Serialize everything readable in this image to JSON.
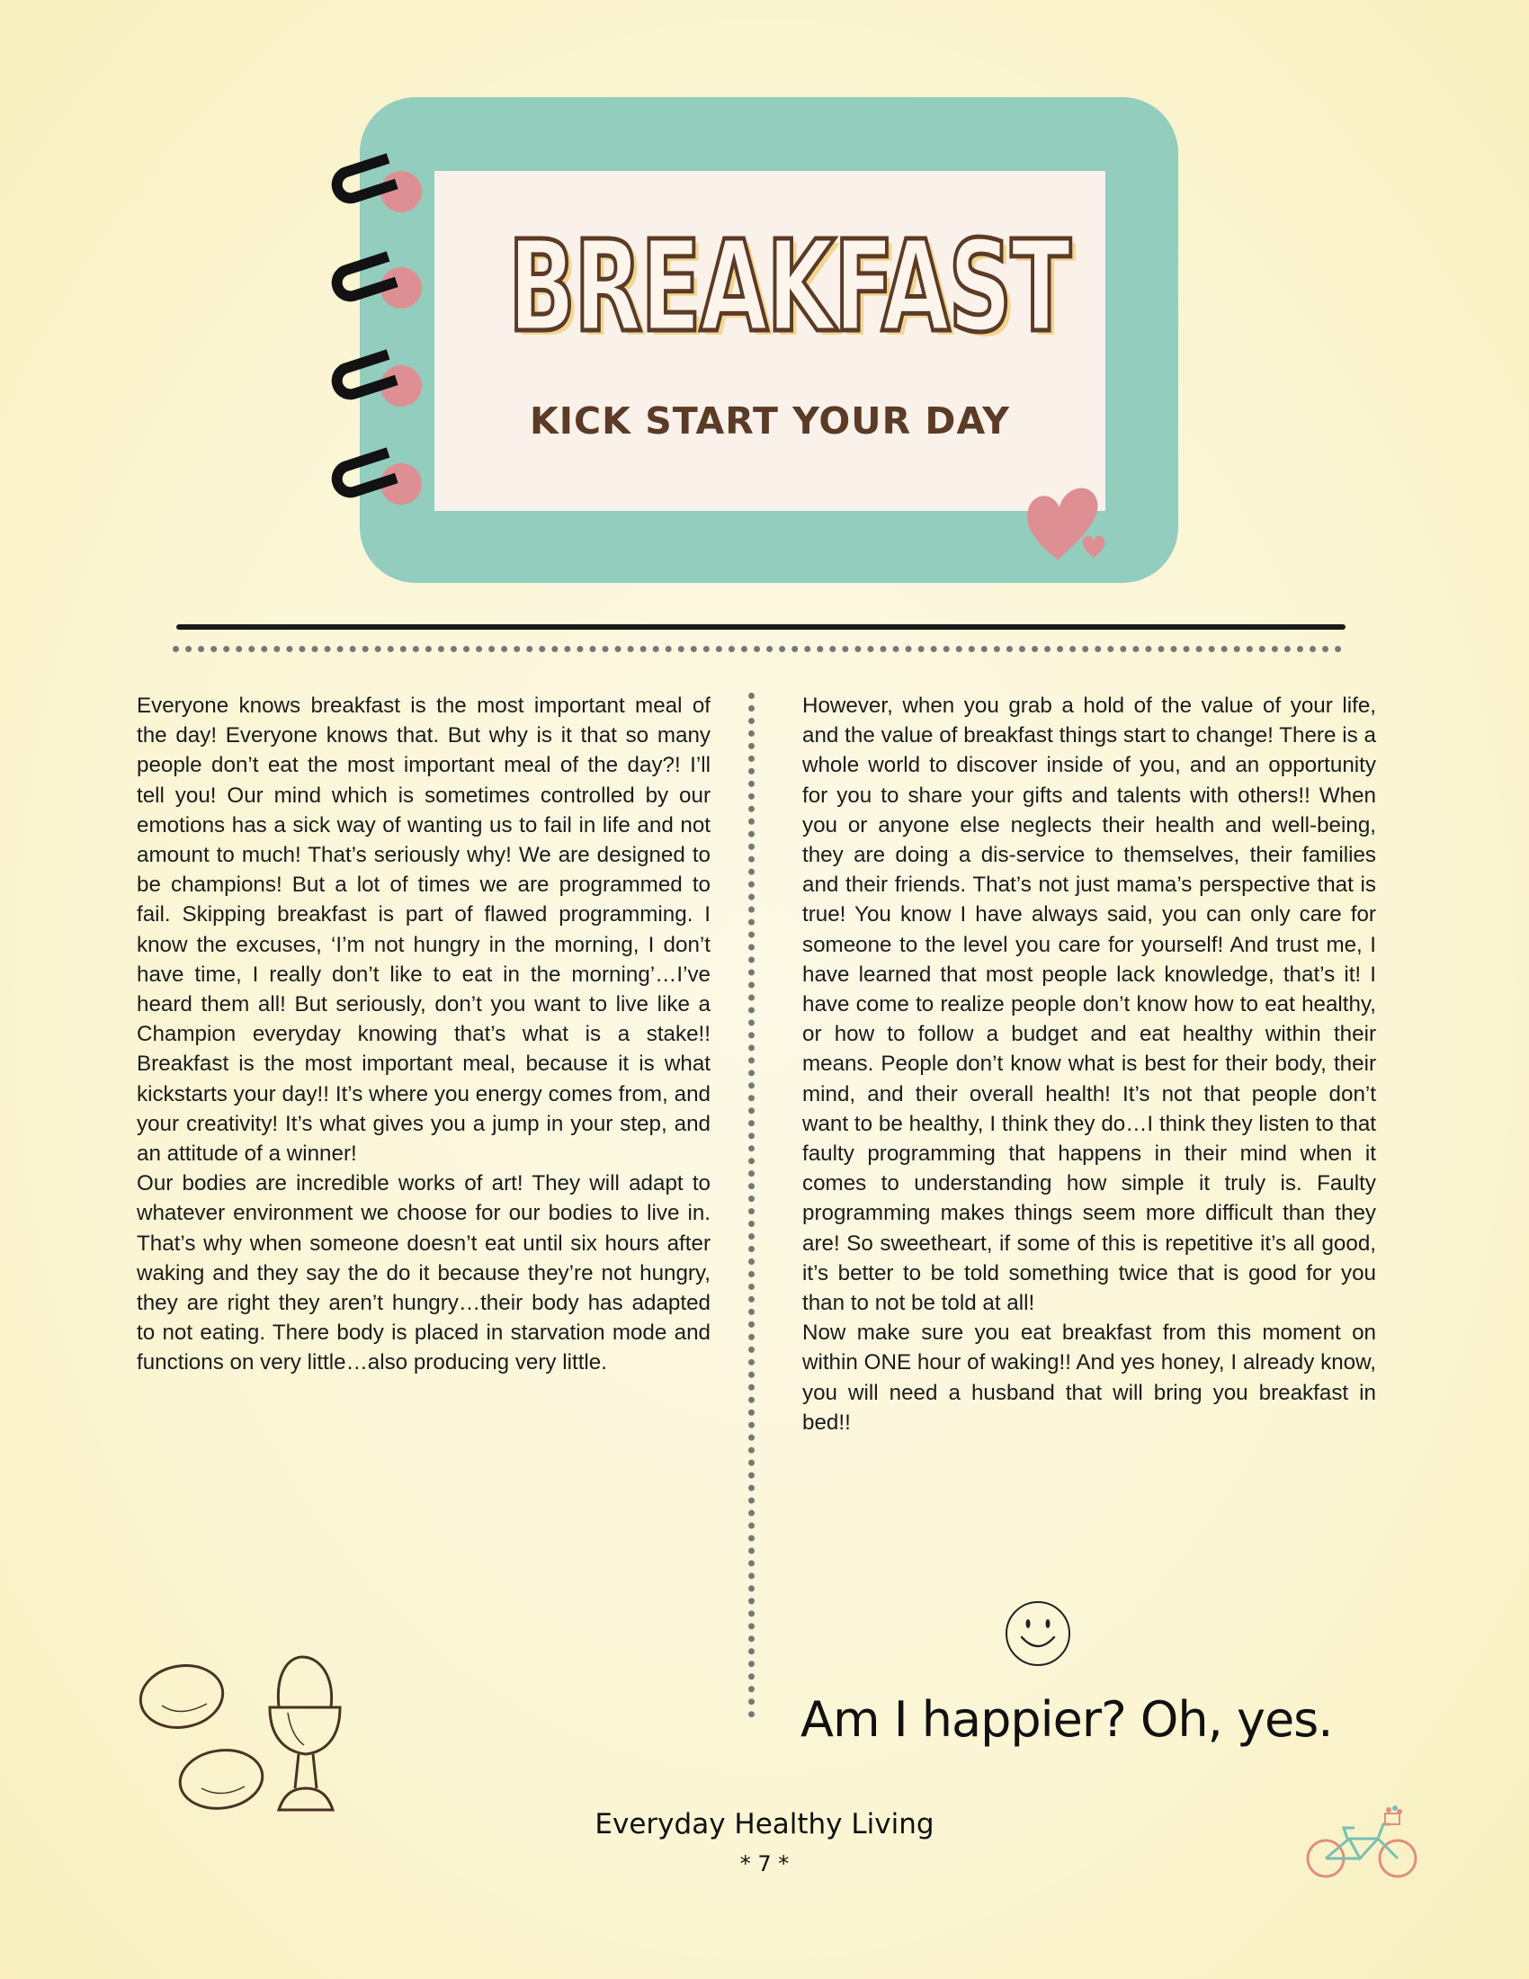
{
  "header": {
    "title": "BREAKFAST",
    "subtitle": "KICK START YOUR DAY"
  },
  "content": {
    "left_column": [
      "Everyone knows breakfast is the most important meal of the day! Everyone knows that. But why is it that so many people don’t eat the most important meal of the day?! I’ll tell you! Our mind which is sometimes controlled by our emotions has a sick way of wanting us to fail in life and not amount to much! That’s seriously why! We are designed to be champions! But a lot of times we are programmed to fail. Skipping breakfast is part of flawed programming. I know the excuses, ‘I’m not hungry in the morning, I don’t have time, I really don’t like to eat in the morning’…I’ve heard them all! But seriously, don’t you want to live like a Champion everyday knowing that’s what is a stake!! Breakfast is the most important meal, because it is what kickstarts your day!! It’s where you energy comes from, and your creativity! It’s what gives you a jump in your step, and an attitude of a winner!",
      "Our bodies are incredible works of art! They will adapt to whatever environment we choose for our bodies to live in. That’s why when someone doesn’t eat until six hours after waking and they say the do it because they’re not hungry, they are right they aren’t hungry…their body has adapted to not eating. There body is placed in starvation mode and functions on very little…also producing very little."
    ],
    "right_column": [
      "However, when you grab a hold of the value of your life, and the value of breakfast things start to change! There is a whole world to discover inside of you, and an opportunity for you to share your gifts and talents with others!! When you or anyone else neglects their health and well-being, they are doing a dis-service to themselves, their families and their friends. That’s not just mama’s perspective that is true! You know I have always said, you can only care for someone to the level you care for yourself! And trust me, I have learned that most people lack knowledge, that’s it! I have come to realize people don’t know how to eat healthy, or how to follow a budget and eat healthy within their means. People don’t know what is best for their body, their mind, and their overall health! It’s not that people don’t want to be healthy, I think they do…I think they listen to that faulty programming that happens in their mind when it comes to understanding how simple it truly is. Faulty programming makes things seem more difficult than they are! So sweetheart, if some of this is repetitive it’s all good, it’s better to be told something twice that is good for you than to not be told at all!",
      "Now make sure you eat breakfast from this moment on within ONE hour of waking!! And yes honey, I already know, you will need a husband that will bring you breakfast in bed!!"
    ]
  },
  "tagline": "Am I happier? Oh, yes.",
  "footer": {
    "title": "Everyday Healthy Living",
    "page": "* 7 *"
  },
  "colors": {
    "notebook_teal": "#92cdbe",
    "paper": "#f9f1ea",
    "title_brown": "#5b3b26",
    "ring_pink": "#de8f93",
    "heart_pink": "#de8f93"
  },
  "icons": [
    "spiral-ring-icon",
    "heart-icon",
    "smiley-icon",
    "eggs-icon",
    "egg-cup-icon",
    "bicycle-icon"
  ]
}
